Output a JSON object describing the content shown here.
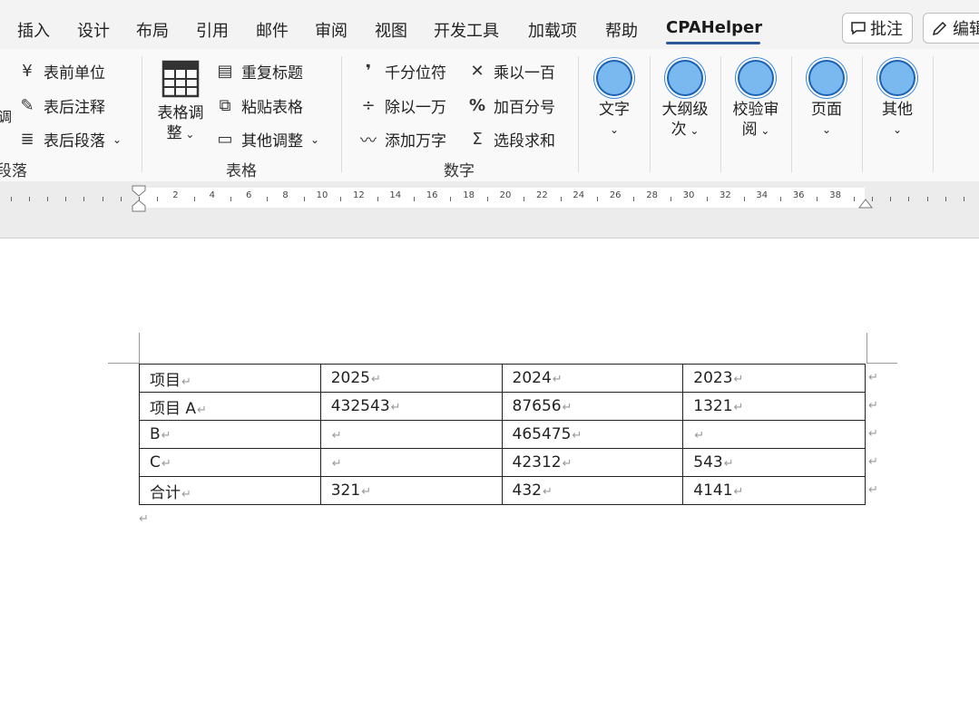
{
  "tabs": [
    {
      "label": "插入"
    },
    {
      "label": "设计"
    },
    {
      "label": "布局"
    },
    {
      "label": "引用"
    },
    {
      "label": "邮件"
    },
    {
      "label": "审阅"
    },
    {
      "label": "视图"
    },
    {
      "label": "开发工具"
    },
    {
      "label": "加载项"
    },
    {
      "label": "帮助"
    },
    {
      "label": "CPAHelper"
    }
  ],
  "tab_buttons": {
    "comment": "批注",
    "edit": "编辑"
  },
  "ribbon": {
    "paragraph_group": {
      "label": "段落",
      "items": [
        "表前单位",
        "表后注释",
        "表后段落"
      ],
      "cut_text": "调"
    },
    "table_group": {
      "label": "表格",
      "big_button_line1": "表格调",
      "big_button_line2": "整",
      "items": [
        "重复标题",
        "粘贴表格",
        "其他调整"
      ]
    },
    "number_group": {
      "label": "数字",
      "items_left": [
        "千分位符",
        "除以一万",
        "添加万字"
      ],
      "items_right": [
        "乘以一百",
        "加百分号",
        "选段求和"
      ]
    },
    "big_buttons": [
      {
        "line1": "文字",
        "line2": ""
      },
      {
        "line1": "大纲级",
        "line2": "次"
      },
      {
        "line1": "校验审",
        "line2": "阅"
      },
      {
        "line1": "页面",
        "line2": ""
      },
      {
        "line1": "其他",
        "line2": ""
      }
    ]
  },
  "ruler": {
    "numbers": [
      "2",
      "4",
      "6",
      "8",
      "10",
      "12",
      "14",
      "16",
      "18",
      "20",
      "22",
      "24",
      "26",
      "28",
      "30",
      "32",
      "34",
      "36",
      "38"
    ]
  },
  "table": {
    "rows": [
      [
        "项目",
        "2025",
        "2024",
        "2023"
      ],
      [
        "项目 A",
        "432543",
        "87656",
        "1321"
      ],
      [
        "B",
        "",
        "465475",
        ""
      ],
      [
        "C",
        "",
        "42312",
        "543"
      ],
      [
        "合计",
        "321",
        "432",
        "4141"
      ]
    ],
    "cell_mark": "↵",
    "paragraph_mark": "↵"
  },
  "colors": {
    "accent": "#2b579a",
    "circle_fill": "#7ab8f0",
    "circle_border": "#1a62b3"
  }
}
